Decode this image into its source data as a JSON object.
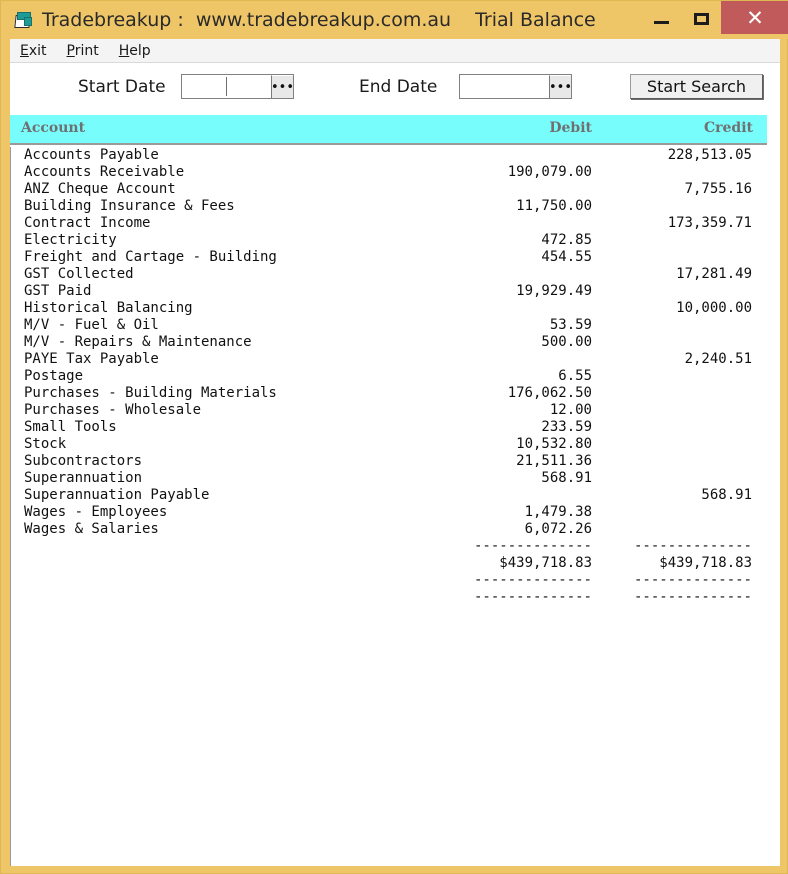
{
  "window": {
    "title_main": "Tradebreakup :  www.tradebreakup.com.au",
    "title_sub": "Trial Balance",
    "icon": "document-folder-icon",
    "controls": {
      "minimize": "minimize-icon",
      "maximize": "maximize-icon",
      "close_label": "✕"
    },
    "colors": {
      "titlebar": "#efc667",
      "close_button": "#c15b5b",
      "header_row": "#78fdfd",
      "header_text": "#707070"
    }
  },
  "menubar": {
    "items": [
      {
        "accel": "E",
        "rest": "xit"
      },
      {
        "accel": "P",
        "rest": "rint"
      },
      {
        "accel": "H",
        "rest": "elp"
      }
    ]
  },
  "toolbar": {
    "start_date_label": "Start Date",
    "start_date_value": "",
    "start_date_placeholder": "",
    "end_date_label": "End Date",
    "end_date_value": "",
    "end_date_placeholder": "",
    "browse_label": "•••",
    "search_label": "Start Search"
  },
  "table": {
    "columns": {
      "account": "Account",
      "debit": "Debit",
      "credit": "Credit"
    },
    "rows": [
      {
        "account": "Accounts Payable",
        "debit": "",
        "credit": "228,513.05"
      },
      {
        "account": "Accounts Receivable",
        "debit": "190,079.00",
        "credit": ""
      },
      {
        "account": "ANZ Cheque Account",
        "debit": "",
        "credit": "7,755.16"
      },
      {
        "account": "Building Insurance & Fees",
        "debit": "11,750.00",
        "credit": ""
      },
      {
        "account": "Contract Income",
        "debit": "",
        "credit": "173,359.71"
      },
      {
        "account": "Electricity",
        "debit": "472.85",
        "credit": ""
      },
      {
        "account": "Freight and Cartage - Building",
        "debit": "454.55",
        "credit": ""
      },
      {
        "account": "GST Collected",
        "debit": "",
        "credit": "17,281.49"
      },
      {
        "account": "GST Paid",
        "debit": "19,929.49",
        "credit": ""
      },
      {
        "account": "Historical Balancing",
        "debit": "",
        "credit": "10,000.00"
      },
      {
        "account": "M/V - Fuel & Oil",
        "debit": "53.59",
        "credit": ""
      },
      {
        "account": "M/V - Repairs & Maintenance",
        "debit": "500.00",
        "credit": ""
      },
      {
        "account": "PAYE Tax Payable",
        "debit": "",
        "credit": "2,240.51"
      },
      {
        "account": "Postage",
        "debit": "6.55",
        "credit": ""
      },
      {
        "account": "Purchases - Building Materials",
        "debit": "176,062.50",
        "credit": ""
      },
      {
        "account": "Purchases - Wholesale",
        "debit": "12.00",
        "credit": ""
      },
      {
        "account": "Small Tools",
        "debit": "233.59",
        "credit": ""
      },
      {
        "account": "Stock",
        "debit": "10,532.80",
        "credit": ""
      },
      {
        "account": "Subcontractors",
        "debit": "21,511.36",
        "credit": ""
      },
      {
        "account": "Superannuation",
        "debit": "568.91",
        "credit": ""
      },
      {
        "account": "Superannuation Payable",
        "debit": "",
        "credit": "568.91"
      },
      {
        "account": "Wages - Employees",
        "debit": "1,479.38",
        "credit": ""
      },
      {
        "account": "Wages & Salaries",
        "debit": "6,072.26",
        "credit": ""
      },
      {
        "account": "",
        "debit": "--------------",
        "credit": "--------------"
      },
      {
        "account": "",
        "debit": "$439,718.83",
        "credit": "$439,718.83"
      },
      {
        "account": "",
        "debit": "--------------",
        "credit": "--------------"
      },
      {
        "account": "",
        "debit": "--------------",
        "credit": "--------------"
      }
    ]
  }
}
